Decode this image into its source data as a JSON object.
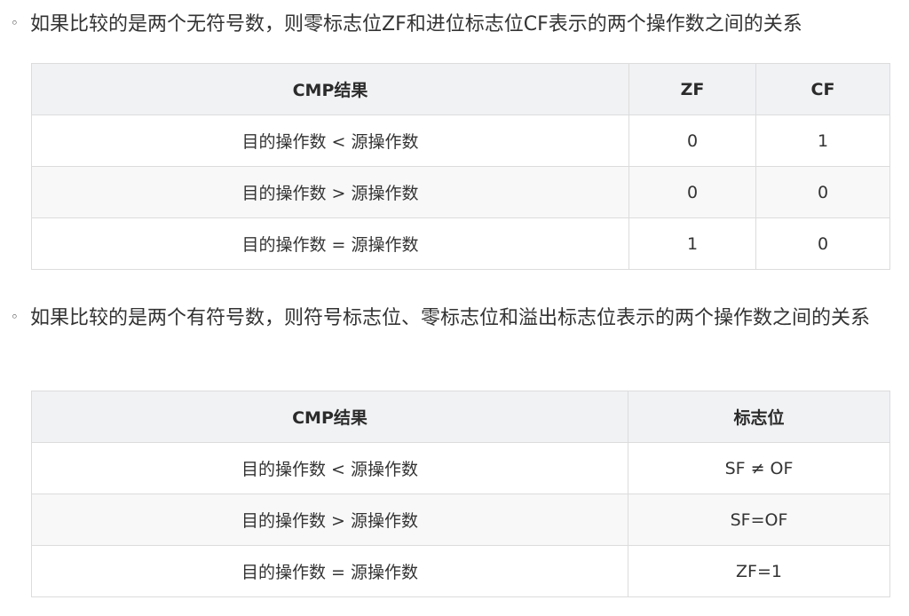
{
  "section1": {
    "bullet": "◦",
    "text": "如果比较的是两个无符号数，则零标志位ZF和进位标志位CF表示的两个操作数之间的关系",
    "table": {
      "headers": [
        "CMP结果",
        "ZF",
        "CF"
      ],
      "rows": [
        [
          "目的操作数 < 源操作数",
          "0",
          "1"
        ],
        [
          "目的操作数 > 源操作数",
          "0",
          "0"
        ],
        [
          "目的操作数 = 源操作数",
          "1",
          "0"
        ]
      ]
    }
  },
  "section2": {
    "bullet": "◦",
    "text": "如果比较的是两个有符号数，则符号标志位、零标志位和溢出标志位表示的两个操作数之间的关系",
    "table": {
      "headers": [
        "CMP结果",
        "标志位"
      ],
      "rows": [
        [
          "目的操作数 < 源操作数",
          "SF ≠ OF"
        ],
        [
          "目的操作数 > 源操作数",
          "SF=OF"
        ],
        [
          "目的操作数 = 源操作数",
          "ZF=1"
        ]
      ]
    }
  }
}
